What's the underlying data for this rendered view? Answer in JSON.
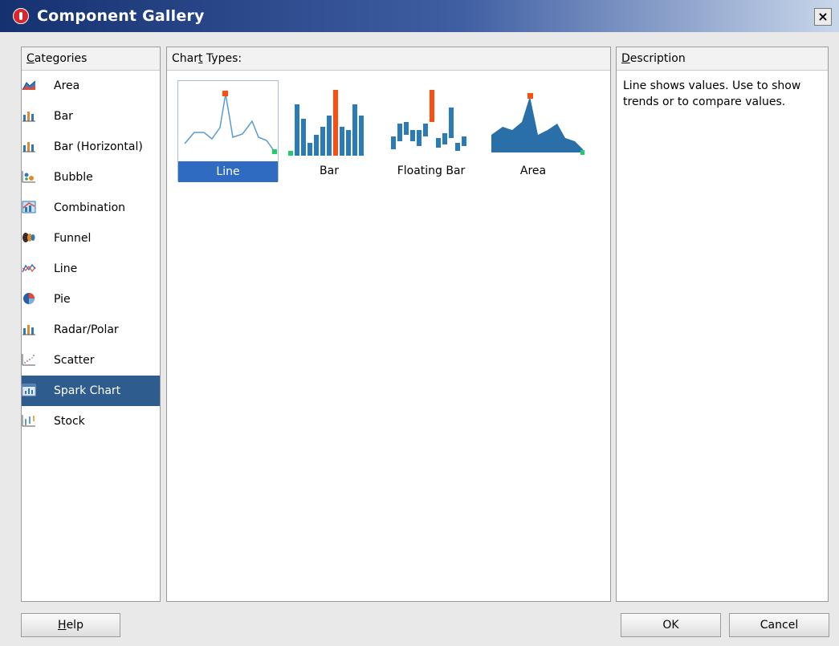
{
  "window": {
    "title": "Component Gallery",
    "close_label": "×"
  },
  "categories": {
    "header_prefix": "",
    "header_mnemonic": "C",
    "header_rest": "ategories",
    "items": [
      {
        "label": "Area",
        "icon": "area-icon"
      },
      {
        "label": "Bar",
        "icon": "bar-icon"
      },
      {
        "label": "Bar (Horizontal)",
        "icon": "bar-horizontal-icon"
      },
      {
        "label": "Bubble",
        "icon": "bubble-icon"
      },
      {
        "label": "Combination",
        "icon": "combination-icon"
      },
      {
        "label": "Funnel",
        "icon": "funnel-icon"
      },
      {
        "label": "Line",
        "icon": "line-icon"
      },
      {
        "label": "Pie",
        "icon": "pie-icon"
      },
      {
        "label": "Radar/Polar",
        "icon": "radar-icon"
      },
      {
        "label": "Scatter",
        "icon": "scatter-icon"
      },
      {
        "label": "Spark Chart",
        "icon": "spark-chart-icon",
        "selected": true
      },
      {
        "label": "Stock",
        "icon": "stock-icon"
      }
    ]
  },
  "chart_types": {
    "header_prefix": "Char",
    "header_mnemonic": "t",
    "header_rest": " Types:",
    "items": [
      {
        "label": "Line",
        "icon": "line-spark-icon",
        "selected": true
      },
      {
        "label": "Bar",
        "icon": "bar-spark-icon"
      },
      {
        "label": "Floating Bar",
        "icon": "floating-bar-spark-icon"
      },
      {
        "label": "Area",
        "icon": "area-spark-icon"
      }
    ]
  },
  "description": {
    "header_prefix": "",
    "header_mnemonic": "D",
    "header_rest": "escription",
    "text": "Line shows values. Use to show trends or to compare values."
  },
  "buttons": {
    "help_mnemonic": "H",
    "help_rest": "elp",
    "ok": "OK",
    "cancel": "Cancel"
  },
  "colors": {
    "title_bar_start": "#153170",
    "selection": "#2f5c8f",
    "tile_selection": "#2f6bc0",
    "spark_blue": "#2b7bb9",
    "spark_highlight": "#ff4c0f",
    "spark_low": "#22cc66"
  }
}
